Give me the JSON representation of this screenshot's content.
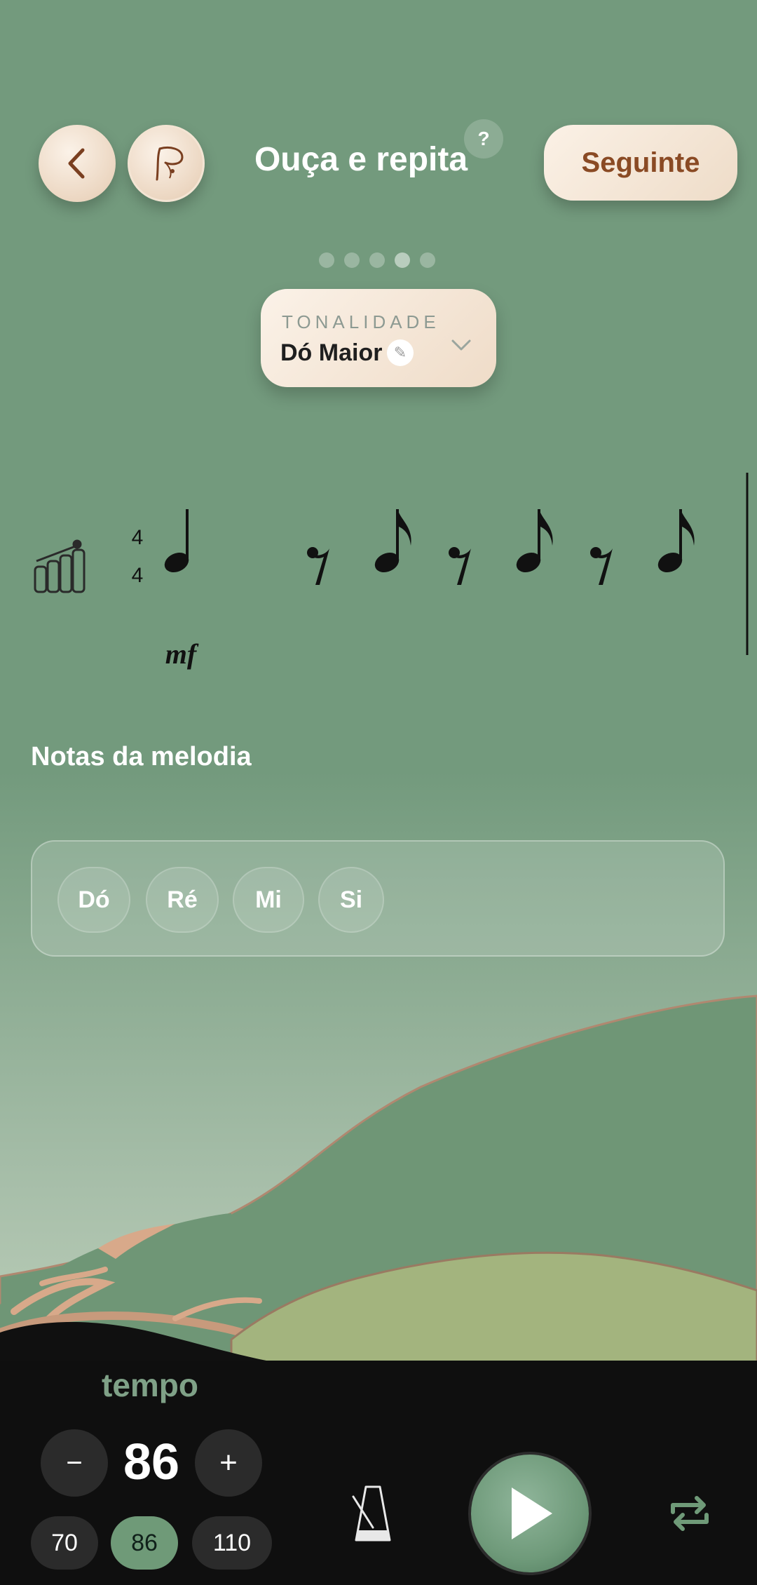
{
  "header": {
    "title": "Ouça e repita",
    "help_label": "?",
    "next_label": "Seguinte"
  },
  "pager": {
    "count": 5,
    "active_index": 3
  },
  "key_selector": {
    "label": "TONALIDADE",
    "value": "Dó Maior",
    "edit_icon": "✎"
  },
  "score": {
    "time_signature": [
      "4",
      "4"
    ],
    "dynamic": "mf",
    "instrument_icon": "xylophone-icon"
  },
  "melody": {
    "title": "Notas da melodia",
    "notes": [
      "Dó",
      "Ré",
      "Mi",
      "Si"
    ]
  },
  "tempo": {
    "label": "tempo",
    "value": "86",
    "minus_label": "−",
    "plus_label": "+",
    "presets": [
      "70",
      "86",
      "110"
    ],
    "active_preset": "86"
  },
  "colors": {
    "background": "#739b7d",
    "accent_brown": "#8a4a24",
    "cream": "#f3e4d3",
    "bar_dark": "#0f0f0f",
    "tempo_green": "#7fa187"
  }
}
